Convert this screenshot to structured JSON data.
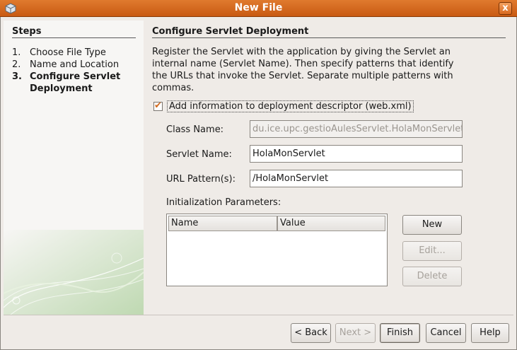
{
  "window": {
    "title": "New File",
    "close_glyph": "x",
    "icon": "app-cube-icon"
  },
  "steps": {
    "heading": "Steps",
    "items": [
      {
        "num": "1.",
        "label": "Choose File Type",
        "current": false
      },
      {
        "num": "2.",
        "label": "Name and Location",
        "current": false
      },
      {
        "num": "3.",
        "label": "Configure Servlet Deployment",
        "current": true
      }
    ]
  },
  "panel": {
    "title": "Configure Servlet Deployment",
    "description": "Register the Servlet with the application by giving the Servlet an internal name (Servlet Name). Then specify patterns that identify the URLs that invoke the Servlet. Separate multiple patterns with commas.",
    "add_to_descriptor": {
      "label": "Add information to deployment descriptor (web.xml)",
      "checked": true
    },
    "class_name": {
      "label": "Class Name:",
      "value": "du.ice.upc.gestioAulesServlet.HolaMonServlet",
      "enabled": false
    },
    "servlet_name": {
      "label": "Servlet Name:",
      "value": "HolaMonServlet"
    },
    "url_pattern": {
      "label": "URL Pattern(s):",
      "value": "/HolaMonServlet"
    },
    "init_params": {
      "label": "Initialization Parameters:",
      "columns": [
        "Name",
        "Value"
      ],
      "rows": []
    },
    "param_buttons": {
      "new": "New",
      "edit": "Edit...",
      "delete": "Delete"
    }
  },
  "footer": {
    "back": "< Back",
    "next": "Next >",
    "finish": "Finish",
    "cancel": "Cancel",
    "help": "Help"
  },
  "colors": {
    "titlebar": "#d0651a",
    "check_accent": "#d06a1f"
  }
}
